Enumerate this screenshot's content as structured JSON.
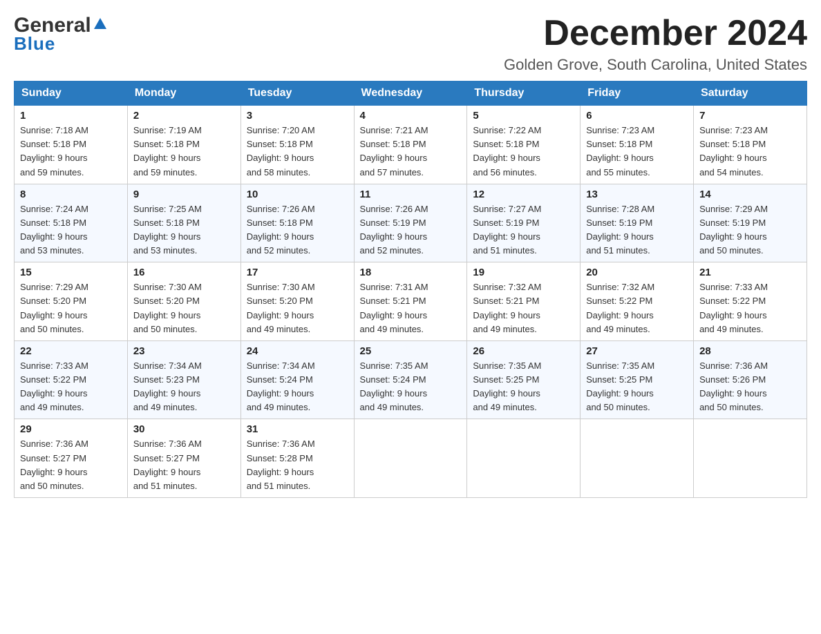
{
  "header": {
    "logo_general": "General",
    "logo_blue": "Blue",
    "month_title": "December 2024",
    "location": "Golden Grove, South Carolina, United States"
  },
  "calendar": {
    "days_of_week": [
      "Sunday",
      "Monday",
      "Tuesday",
      "Wednesday",
      "Thursday",
      "Friday",
      "Saturday"
    ],
    "weeks": [
      [
        {
          "day": "1",
          "sunrise": "7:18 AM",
          "sunset": "5:18 PM",
          "daylight": "9 hours and 59 minutes."
        },
        {
          "day": "2",
          "sunrise": "7:19 AM",
          "sunset": "5:18 PM",
          "daylight": "9 hours and 59 minutes."
        },
        {
          "day": "3",
          "sunrise": "7:20 AM",
          "sunset": "5:18 PM",
          "daylight": "9 hours and 58 minutes."
        },
        {
          "day": "4",
          "sunrise": "7:21 AM",
          "sunset": "5:18 PM",
          "daylight": "9 hours and 57 minutes."
        },
        {
          "day": "5",
          "sunrise": "7:22 AM",
          "sunset": "5:18 PM",
          "daylight": "9 hours and 56 minutes."
        },
        {
          "day": "6",
          "sunrise": "7:23 AM",
          "sunset": "5:18 PM",
          "daylight": "9 hours and 55 minutes."
        },
        {
          "day": "7",
          "sunrise": "7:23 AM",
          "sunset": "5:18 PM",
          "daylight": "9 hours and 54 minutes."
        }
      ],
      [
        {
          "day": "8",
          "sunrise": "7:24 AM",
          "sunset": "5:18 PM",
          "daylight": "9 hours and 53 minutes."
        },
        {
          "day": "9",
          "sunrise": "7:25 AM",
          "sunset": "5:18 PM",
          "daylight": "9 hours and 53 minutes."
        },
        {
          "day": "10",
          "sunrise": "7:26 AM",
          "sunset": "5:18 PM",
          "daylight": "9 hours and 52 minutes."
        },
        {
          "day": "11",
          "sunrise": "7:26 AM",
          "sunset": "5:19 PM",
          "daylight": "9 hours and 52 minutes."
        },
        {
          "day": "12",
          "sunrise": "7:27 AM",
          "sunset": "5:19 PM",
          "daylight": "9 hours and 51 minutes."
        },
        {
          "day": "13",
          "sunrise": "7:28 AM",
          "sunset": "5:19 PM",
          "daylight": "9 hours and 51 minutes."
        },
        {
          "day": "14",
          "sunrise": "7:29 AM",
          "sunset": "5:19 PM",
          "daylight": "9 hours and 50 minutes."
        }
      ],
      [
        {
          "day": "15",
          "sunrise": "7:29 AM",
          "sunset": "5:20 PM",
          "daylight": "9 hours and 50 minutes."
        },
        {
          "day": "16",
          "sunrise": "7:30 AM",
          "sunset": "5:20 PM",
          "daylight": "9 hours and 50 minutes."
        },
        {
          "day": "17",
          "sunrise": "7:30 AM",
          "sunset": "5:20 PM",
          "daylight": "9 hours and 49 minutes."
        },
        {
          "day": "18",
          "sunrise": "7:31 AM",
          "sunset": "5:21 PM",
          "daylight": "9 hours and 49 minutes."
        },
        {
          "day": "19",
          "sunrise": "7:32 AM",
          "sunset": "5:21 PM",
          "daylight": "9 hours and 49 minutes."
        },
        {
          "day": "20",
          "sunrise": "7:32 AM",
          "sunset": "5:22 PM",
          "daylight": "9 hours and 49 minutes."
        },
        {
          "day": "21",
          "sunrise": "7:33 AM",
          "sunset": "5:22 PM",
          "daylight": "9 hours and 49 minutes."
        }
      ],
      [
        {
          "day": "22",
          "sunrise": "7:33 AM",
          "sunset": "5:22 PM",
          "daylight": "9 hours and 49 minutes."
        },
        {
          "day": "23",
          "sunrise": "7:34 AM",
          "sunset": "5:23 PM",
          "daylight": "9 hours and 49 minutes."
        },
        {
          "day": "24",
          "sunrise": "7:34 AM",
          "sunset": "5:24 PM",
          "daylight": "9 hours and 49 minutes."
        },
        {
          "day": "25",
          "sunrise": "7:35 AM",
          "sunset": "5:24 PM",
          "daylight": "9 hours and 49 minutes."
        },
        {
          "day": "26",
          "sunrise": "7:35 AM",
          "sunset": "5:25 PM",
          "daylight": "9 hours and 49 minutes."
        },
        {
          "day": "27",
          "sunrise": "7:35 AM",
          "sunset": "5:25 PM",
          "daylight": "9 hours and 50 minutes."
        },
        {
          "day": "28",
          "sunrise": "7:36 AM",
          "sunset": "5:26 PM",
          "daylight": "9 hours and 50 minutes."
        }
      ],
      [
        {
          "day": "29",
          "sunrise": "7:36 AM",
          "sunset": "5:27 PM",
          "daylight": "9 hours and 50 minutes."
        },
        {
          "day": "30",
          "sunrise": "7:36 AM",
          "sunset": "5:27 PM",
          "daylight": "9 hours and 51 minutes."
        },
        {
          "day": "31",
          "sunrise": "7:36 AM",
          "sunset": "5:28 PM",
          "daylight": "9 hours and 51 minutes."
        },
        null,
        null,
        null,
        null
      ]
    ]
  },
  "labels": {
    "sunrise_label": "Sunrise:",
    "sunset_label": "Sunset:",
    "daylight_label": "Daylight:"
  }
}
